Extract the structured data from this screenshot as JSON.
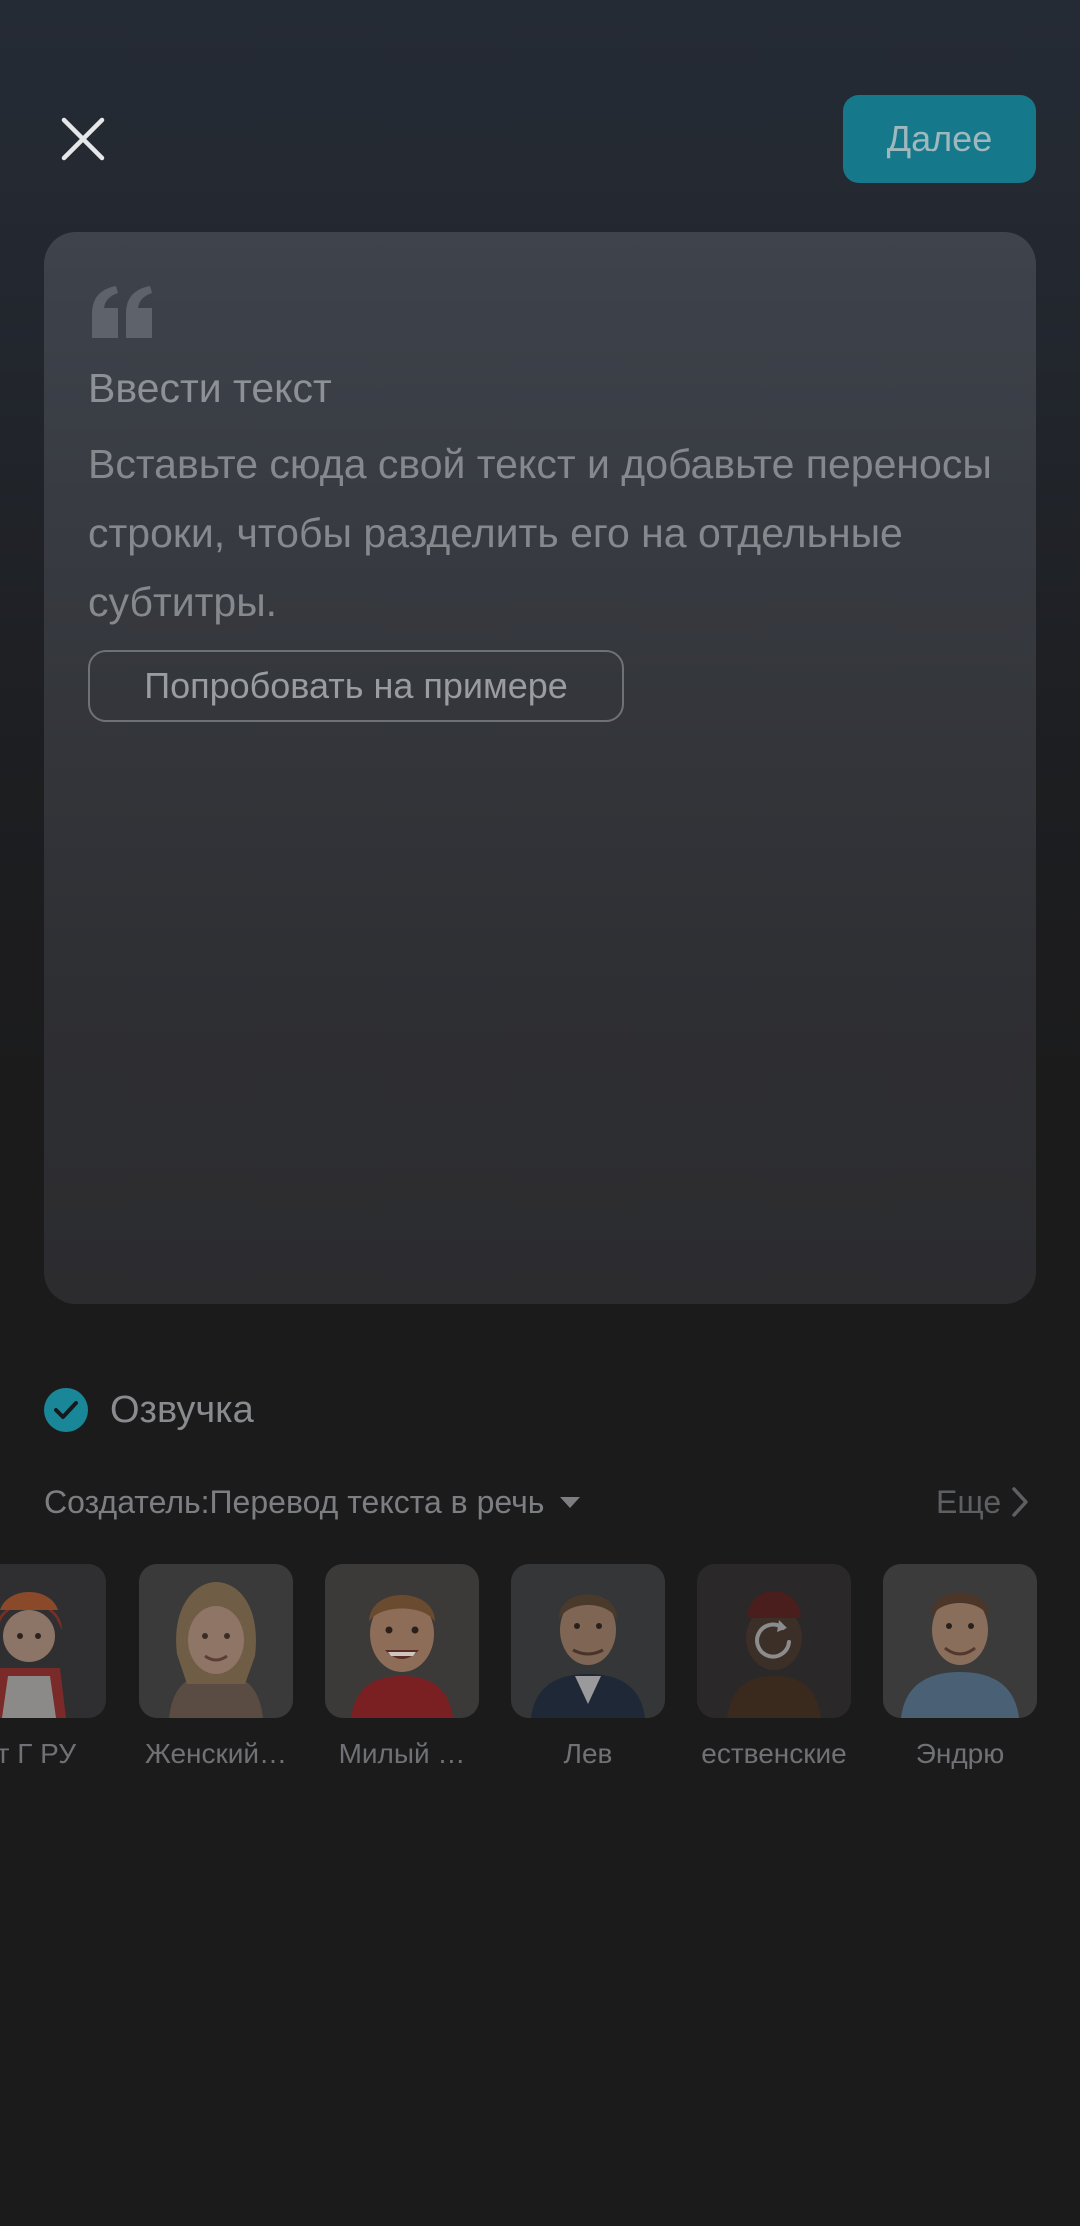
{
  "header": {
    "close_icon": "close-icon",
    "next_label": "Далее",
    "accent_color": "#16798b"
  },
  "editor": {
    "quote_icon": "quote-icon",
    "title": "Ввести текст",
    "body": "Вставьте сюда свой текст и добавьте переносы строки, чтобы разделить его на отдельные субтитры.",
    "example_button": "Попробовать на примере"
  },
  "voiceover": {
    "checked": true,
    "label": "Озвучка"
  },
  "creator": {
    "label": "Создатель:Перевод текста в речь",
    "more_label": "Еще"
  },
  "voices": [
    {
      "name": "ет Г РУ",
      "avatar_icon": "girl-folk-costume-avatar"
    },
    {
      "name": "Женский…",
      "avatar_icon": "young-woman-avatar"
    },
    {
      "name": "Милый …",
      "avatar_icon": "smiling-boy-avatar"
    },
    {
      "name": "Лев",
      "avatar_icon": "man-suit-avatar"
    },
    {
      "name": "ественские",
      "avatar_icon": "loading-avatar"
    },
    {
      "name": "Эндрю",
      "avatar_icon": "man-denim-shirt-avatar"
    }
  ]
}
